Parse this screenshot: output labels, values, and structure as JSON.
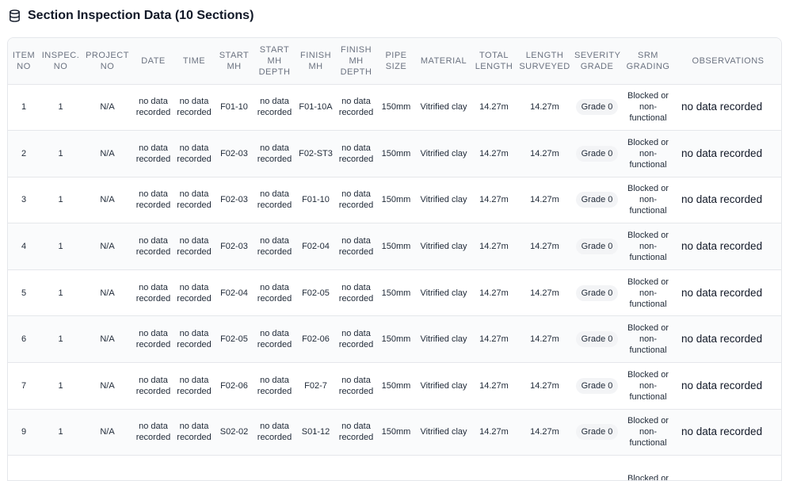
{
  "header": {
    "title": "Section Inspection Data (10 Sections)",
    "icon": "database-icon"
  },
  "columns": [
    "ITEM NO",
    "INSPEC. NO",
    "PROJECT NO",
    "DATE",
    "TIME",
    "START MH",
    "START MH DEPTH",
    "FINISH MH",
    "FINISH MH DEPTH",
    "PIPE SIZE",
    "MATERIAL",
    "TOTAL LENGTH",
    "LENGTH SURVEYED",
    "SEVERITY GRADE",
    "SRM GRADING",
    "OBSERVATIONS"
  ],
  "rows": [
    {
      "item": "1",
      "inspec": "1",
      "project": "N/A",
      "date": "no data recorded",
      "time": "no data recorded",
      "start_mh": "F01-10",
      "start_depth": "no data recorded",
      "finish_mh": "F01-10A",
      "finish_depth": "no data recorded",
      "pipe_size": "150mm",
      "material": "Vitrified clay",
      "total_length": "14.27m",
      "length_surveyed": "14.27m",
      "severity": "Grade 0",
      "srm": "Blocked or non-functional",
      "observations": "no data recorded"
    },
    {
      "item": "2",
      "inspec": "1",
      "project": "N/A",
      "date": "no data recorded",
      "time": "no data recorded",
      "start_mh": "F02-03",
      "start_depth": "no data recorded",
      "finish_mh": "F02-ST3",
      "finish_depth": "no data recorded",
      "pipe_size": "150mm",
      "material": "Vitrified clay",
      "total_length": "14.27m",
      "length_surveyed": "14.27m",
      "severity": "Grade 0",
      "srm": "Blocked or non-functional",
      "observations": "no data recorded"
    },
    {
      "item": "3",
      "inspec": "1",
      "project": "N/A",
      "date": "no data recorded",
      "time": "no data recorded",
      "start_mh": "F02-03",
      "start_depth": "no data recorded",
      "finish_mh": "F01-10",
      "finish_depth": "no data recorded",
      "pipe_size": "150mm",
      "material": "Vitrified clay",
      "total_length": "14.27m",
      "length_surveyed": "14.27m",
      "severity": "Grade 0",
      "srm": "Blocked or non-functional",
      "observations": "no data recorded"
    },
    {
      "item": "4",
      "inspec": "1",
      "project": "N/A",
      "date": "no data recorded",
      "time": "no data recorded",
      "start_mh": "F02-03",
      "start_depth": "no data recorded",
      "finish_mh": "F02-04",
      "finish_depth": "no data recorded",
      "pipe_size": "150mm",
      "material": "Vitrified clay",
      "total_length": "14.27m",
      "length_surveyed": "14.27m",
      "severity": "Grade 0",
      "srm": "Blocked or non-functional",
      "observations": "no data recorded"
    },
    {
      "item": "5",
      "inspec": "1",
      "project": "N/A",
      "date": "no data recorded",
      "time": "no data recorded",
      "start_mh": "F02-04",
      "start_depth": "no data recorded",
      "finish_mh": "F02-05",
      "finish_depth": "no data recorded",
      "pipe_size": "150mm",
      "material": "Vitrified clay",
      "total_length": "14.27m",
      "length_surveyed": "14.27m",
      "severity": "Grade 0",
      "srm": "Blocked or non-functional",
      "observations": "no data recorded"
    },
    {
      "item": "6",
      "inspec": "1",
      "project": "N/A",
      "date": "no data recorded",
      "time": "no data recorded",
      "start_mh": "F02-05",
      "start_depth": "no data recorded",
      "finish_mh": "F02-06",
      "finish_depth": "no data recorded",
      "pipe_size": "150mm",
      "material": "Vitrified clay",
      "total_length": "14.27m",
      "length_surveyed": "14.27m",
      "severity": "Grade 0",
      "srm": "Blocked or non-functional",
      "observations": "no data recorded"
    },
    {
      "item": "7",
      "inspec": "1",
      "project": "N/A",
      "date": "no data recorded",
      "time": "no data recorded",
      "start_mh": "F02-06",
      "start_depth": "no data recorded",
      "finish_mh": "F02-7",
      "finish_depth": "no data recorded",
      "pipe_size": "150mm",
      "material": "Vitrified clay",
      "total_length": "14.27m",
      "length_surveyed": "14.27m",
      "severity": "Grade 0",
      "srm": "Blocked or non-functional",
      "observations": "no data recorded"
    },
    {
      "item": "9",
      "inspec": "1",
      "project": "N/A",
      "date": "no data recorded",
      "time": "no data recorded",
      "start_mh": "S02-02",
      "start_depth": "no data recorded",
      "finish_mh": "S01-12",
      "finish_depth": "no data recorded",
      "pipe_size": "150mm",
      "material": "Vitrified clay",
      "total_length": "14.27m",
      "length_surveyed": "14.27m",
      "severity": "Grade 0",
      "srm": "Blocked or non-functional",
      "observations": "no data recorded"
    },
    {
      "item": "",
      "inspec": "",
      "project": "",
      "date": "",
      "time": "",
      "start_mh": "",
      "start_depth": "",
      "finish_mh": "",
      "finish_depth": "",
      "pipe_size": "",
      "material": "",
      "total_length": "",
      "length_surveyed": "",
      "severity": "",
      "srm": "Blocked or",
      "observations": ""
    }
  ]
}
